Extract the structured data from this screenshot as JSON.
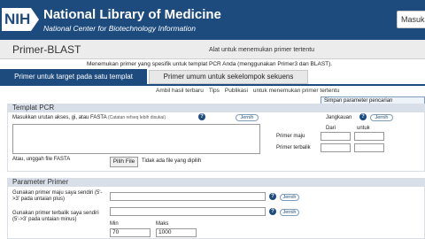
{
  "header": {
    "logo_text": "NIH",
    "title": "National Library of Medicine",
    "subtitle": "National Center for Biotechnology Information",
    "login_label": "Masuk"
  },
  "tool": {
    "name": "Primer-BLAST",
    "tagline": "Alat untuk menemukan primer tertentu",
    "intro": "Menemukan primer yang spesifik untuk templat PCR Anda (menggunakan Primer3 dan BLAST)."
  },
  "tabs": [
    {
      "label": "Primer untuk target pada satu templat",
      "active": true
    },
    {
      "label": "Primer umum untuk sekelompok sekuens",
      "active": false
    }
  ],
  "links": {
    "items": [
      "Ambil hasil terbaru",
      "Tips",
      "Publikasi",
      "untuk menemukan primer tertentu"
    ],
    "save_search": "Simpan parameter pencarian"
  },
  "pcr_template": {
    "section_label": "Templat PCR",
    "accession_label": "Masukkan urutan akses, gi, atau FASTA",
    "accession_note": "(Catatan refseq lebih disukai)",
    "clear_label": "Jernih",
    "range_label": "Jangkauan",
    "range_clear_label": "Jernih",
    "from_label": "Dari",
    "to_label": "untuk",
    "forward_primer_label": "Primer maju",
    "reverse_primer_label": "Primer terbalik",
    "upload_label": "Atau, unggah file FASTA",
    "choose_file_label": "Pilih File",
    "no_file_label": "Tidak ada file yang dipilih"
  },
  "primer_params": {
    "section_label": "Parameter Primer",
    "forward_label": "Gunakan primer maju saya sendiri (5'->3' pada untaian plus)",
    "reverse_label": "Gunakan primer terbalik saya sendiri (5'->3' pada untaian minus)",
    "clear_label": "Jernih",
    "min_label": "Min",
    "max_label": "Maks",
    "min_value": "70",
    "max_value": "1000"
  },
  "colors": {
    "brand": "#1d4b7e",
    "section_bar": "#d8dfe8"
  }
}
